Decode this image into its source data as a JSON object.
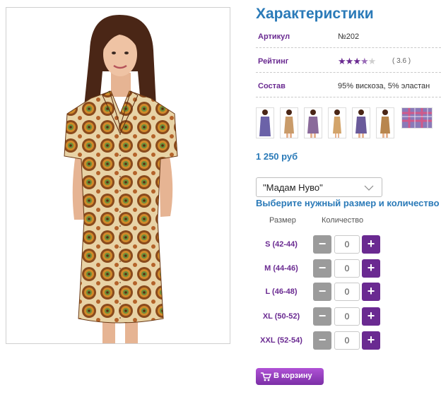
{
  "product_image": {
    "label": "dress-photo"
  },
  "section_title": "Характеристики",
  "attributes": [
    {
      "label": "Артикул",
      "value": "№202"
    },
    {
      "label": "Рейтинг",
      "value": "( 3.6 )"
    },
    {
      "label": "Состав",
      "value": "95% вискоза, 5% эластан"
    }
  ],
  "rating": {
    "value": 3.6,
    "max": 5
  },
  "price": "1 250 руб",
  "brand_select": {
    "value": "\"Мадам Нуво\""
  },
  "size_prompt": "Выберите нужный размер и количество",
  "table_headers": {
    "size": "Размер",
    "quantity": "Количество"
  },
  "sizes": [
    {
      "label": "S (42-44)",
      "qty": "0",
      "minus": "−",
      "plus": "+"
    },
    {
      "label": "M (44-46)",
      "qty": "0",
      "minus": "−",
      "plus": "+"
    },
    {
      "label": "L (46-48)",
      "qty": "0",
      "minus": "−",
      "plus": "+"
    },
    {
      "label": "XL (50-52)",
      "qty": "0",
      "minus": "−",
      "plus": "+"
    },
    {
      "label": "XXL (52-54)",
      "qty": "0",
      "minus": "−",
      "plus": "+"
    }
  ],
  "cart_button": "В корзину",
  "colors": {
    "accent_blue": "#2a7ab8",
    "accent_purple": "#6a2a91",
    "button_gray": "#9b9b9b"
  }
}
